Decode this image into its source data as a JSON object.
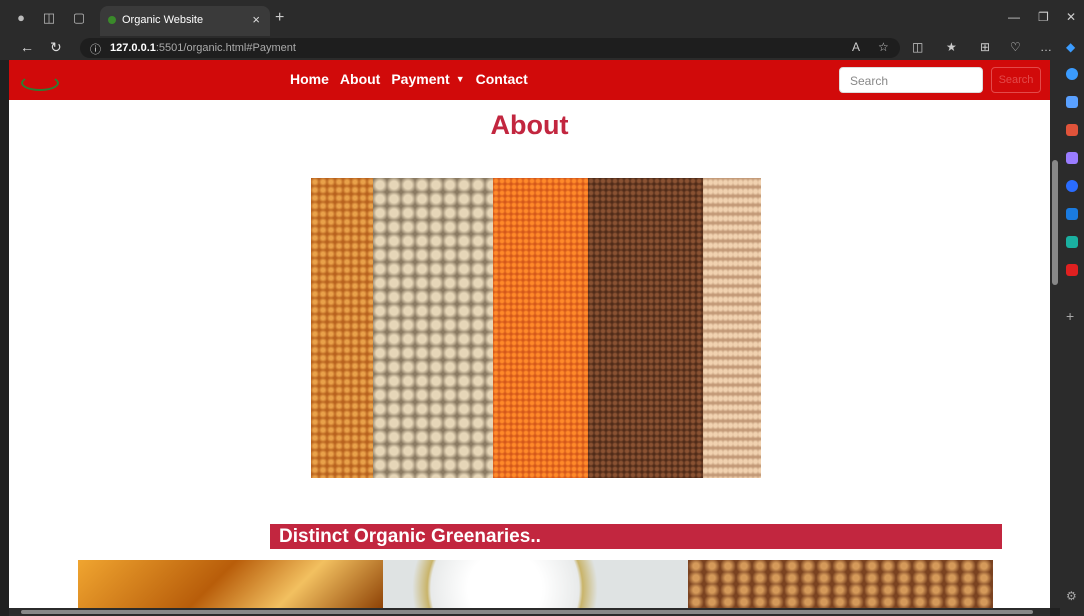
{
  "browser": {
    "tab_title": "Organic Website",
    "tab_close": "×",
    "new_tab": "+",
    "url_host": "127.0.0.1",
    "url_rest": ":5501/organic.html#Payment"
  },
  "site": {
    "nav": {
      "links": [
        "Home",
        "About",
        "Payment",
        "Contact"
      ],
      "dropdown_caret": "▼"
    },
    "search": {
      "placeholder": "Search",
      "button": "Search"
    },
    "heading": "About",
    "subheading": "Distinct Organic Greenaries..",
    "colors": {
      "navbar": "#d10a0a",
      "accent": "#c2263f"
    }
  }
}
